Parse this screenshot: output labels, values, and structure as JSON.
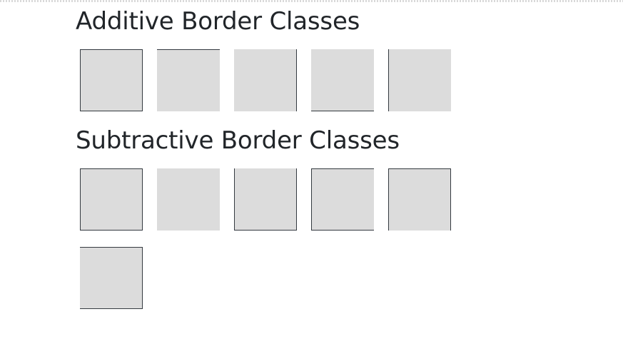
{
  "sections": {
    "additive": {
      "title": "Additive Border Classes",
      "boxes": [
        "border",
        "border-top",
        "border-right",
        "border-bottom",
        "border-left"
      ]
    },
    "subtractive": {
      "title": "Subtractive Border Classes",
      "boxes": [
        "border",
        "border-0",
        "border-top-0",
        "border-right-0",
        "border-bottom-0",
        "border-left-0"
      ]
    }
  },
  "colors": {
    "box_fill": "#dcdcdc",
    "border": "#343a40",
    "heading_text": "#212529"
  }
}
